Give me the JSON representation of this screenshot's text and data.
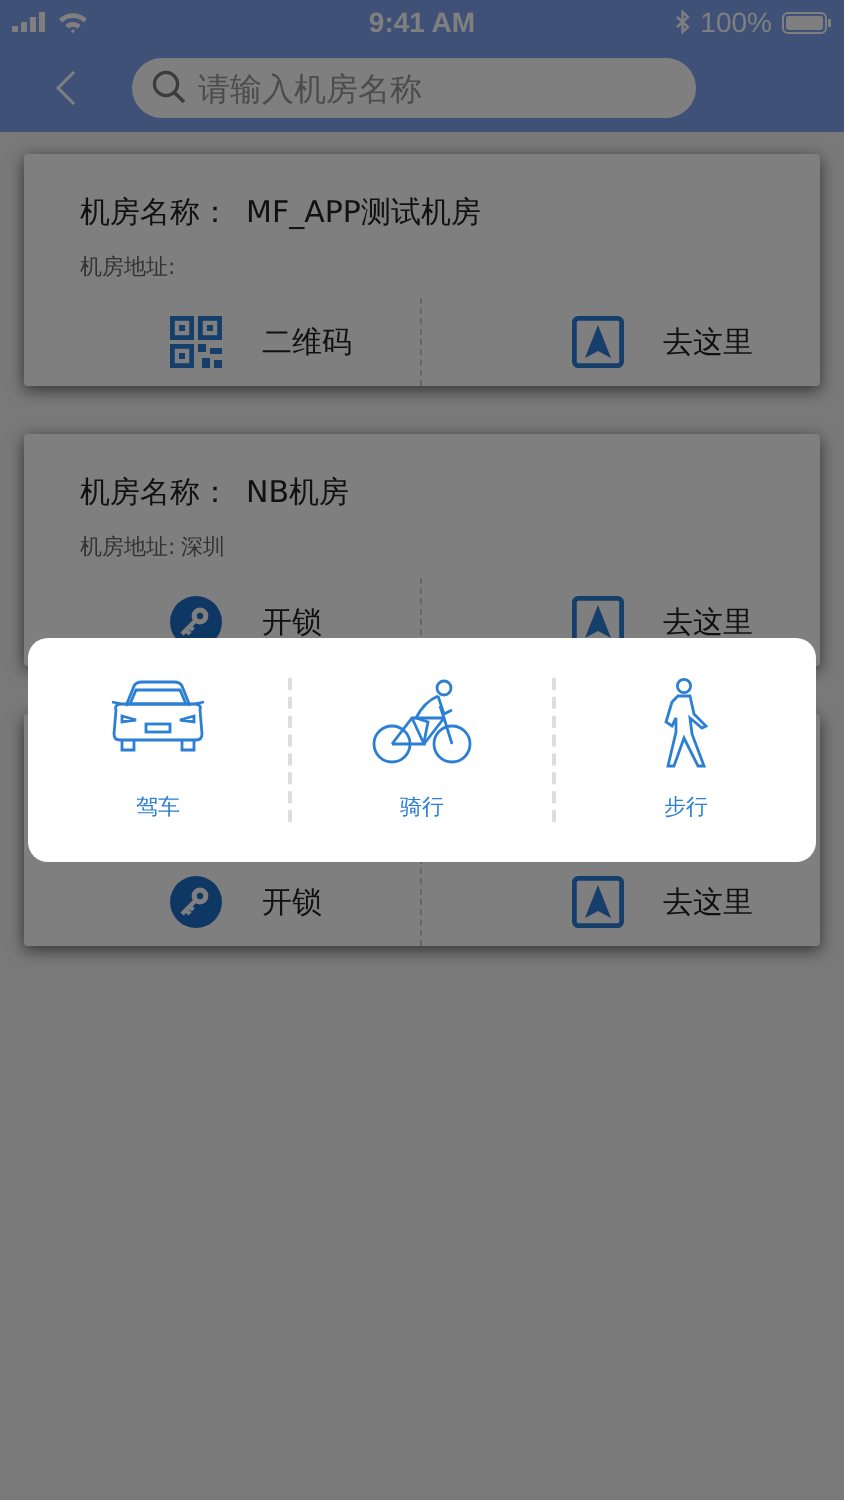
{
  "status_bar": {
    "time": "9:41 AM",
    "battery": "100%"
  },
  "search": {
    "placeholder": "请输入机房名称"
  },
  "cards": [
    {
      "name_label": "机房名称：",
      "name": "MF_APP测试机房",
      "address_label": "机房地址:",
      "actions": [
        {
          "kind": "qr",
          "label": "二维码"
        },
        {
          "kind": "navigate",
          "label": "去这里"
        }
      ]
    },
    {
      "name_label": "机房名称：",
      "name": "NB机房",
      "address_label": "机房地址:",
      "address": "深圳",
      "actions": [
        {
          "kind": "key",
          "label": "开锁"
        },
        {
          "kind": "navigate",
          "label": "去这里"
        }
      ]
    },
    {
      "actions": [
        {
          "kind": "key",
          "label": "开锁"
        },
        {
          "kind": "navigate",
          "label": "去这里"
        }
      ]
    }
  ],
  "travel_modes": [
    {
      "kind": "car",
      "label": "驾车"
    },
    {
      "kind": "bike",
      "label": "骑行"
    },
    {
      "kind": "walk",
      "label": "步行"
    }
  ]
}
